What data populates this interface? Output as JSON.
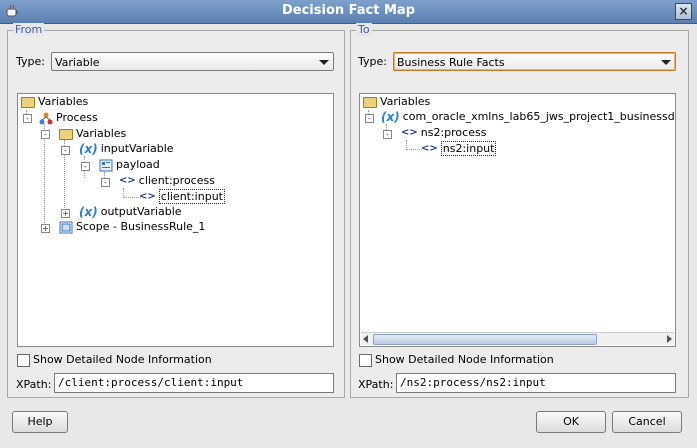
{
  "window": {
    "title": "Decision Fact Map"
  },
  "from": {
    "legend": "From",
    "type_label": "Type:",
    "type_value": "Variable",
    "tree": {
      "root": "Variables",
      "process": "Process",
      "variables": "Variables",
      "input_variable": "inputVariable",
      "payload": "payload",
      "client_process": "client:process",
      "client_input": "client:input",
      "output_variable": "outputVariable",
      "scope": "Scope - BusinessRule_1"
    },
    "show_detail_label": "Show Detailed Node Information",
    "xpath_label": "XPath:",
    "xpath_value": "/client:process/client:input"
  },
  "to": {
    "legend": "To",
    "type_label": "Type:",
    "type_value": "Business Rule Facts",
    "tree": {
      "root": "Variables",
      "var": "com_oracle_xmlns_lab65_jws_project1_businessd",
      "ns2_process": "ns2:process",
      "ns2_input": "ns2:input"
    },
    "show_detail_label": "Show Detailed Node Information",
    "xpath_label": "XPath:",
    "xpath_value": "/ns2:process/ns2:input"
  },
  "buttons": {
    "help": "Help",
    "ok": "OK",
    "cancel": "Cancel"
  }
}
